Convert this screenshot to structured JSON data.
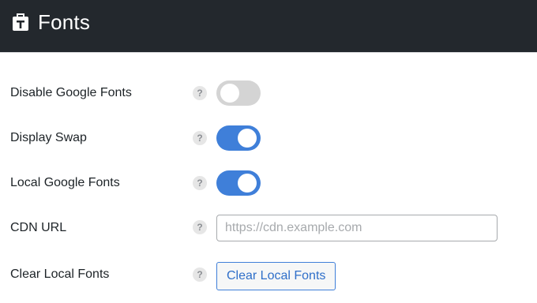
{
  "header": {
    "title": "Fonts",
    "icon": "text-font-icon",
    "background": "#23282d"
  },
  "rows": [
    {
      "label": "Disable Google Fonts",
      "help": "?",
      "control": "toggle",
      "checked": false
    },
    {
      "label": "Display Swap",
      "help": "?",
      "control": "toggle",
      "checked": true
    },
    {
      "label": "Local Google Fonts",
      "help": "?",
      "control": "toggle",
      "checked": true
    },
    {
      "label": "CDN URL",
      "help": "?",
      "control": "text",
      "value": "",
      "placeholder": "https://cdn.example.com"
    },
    {
      "label": "Clear Local Fonts",
      "help": "?",
      "control": "button",
      "button_label": "Clear Local Fonts"
    }
  ],
  "colors": {
    "toggle_on": "#3f7fd9",
    "toggle_off": "#d4d4d4",
    "button_accent": "#3f7fd9"
  }
}
